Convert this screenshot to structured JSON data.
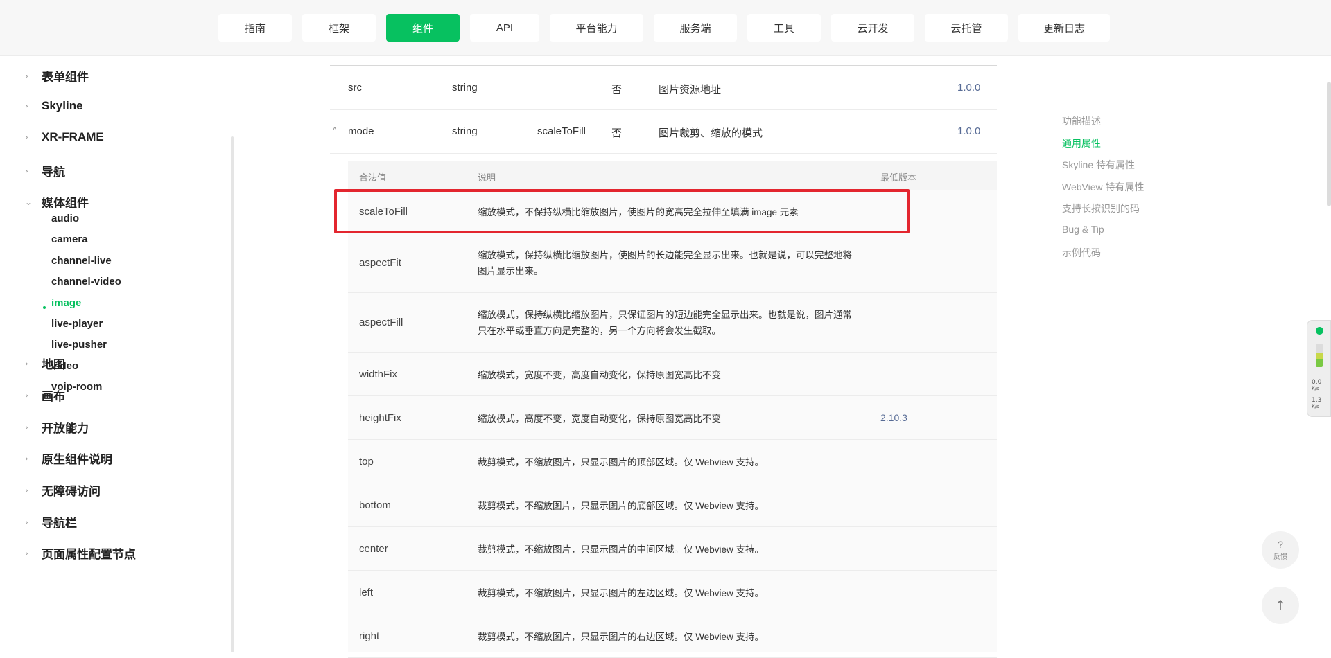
{
  "topnav": {
    "items": [
      {
        "label": "指南",
        "width": 106,
        "active": false
      },
      {
        "label": "框架",
        "width": 106,
        "active": false
      },
      {
        "label": "组件",
        "width": 106,
        "active": true
      },
      {
        "label": "API",
        "width": 100,
        "active": false
      },
      {
        "label": "平台能力",
        "width": 135,
        "active": false
      },
      {
        "label": "服务端",
        "width": 120,
        "active": false
      },
      {
        "label": "工具",
        "width": 106,
        "active": false
      },
      {
        "label": "云开发",
        "width": 120,
        "active": false
      },
      {
        "label": "云托管",
        "width": 120,
        "active": false
      },
      {
        "label": "更新日志",
        "width": 132,
        "active": false
      }
    ]
  },
  "sidebar": {
    "groups_top": [
      {
        "label": "表单组件",
        "chevron": "›"
      },
      {
        "label": "Skyline",
        "chevron": "›"
      },
      {
        "label": "XR-FRAME",
        "chevron": "›"
      },
      {
        "label": "导航",
        "chevron": "›"
      },
      {
        "label": "媒体组件",
        "chevron": "⌄"
      }
    ],
    "media_items": [
      {
        "label": "audio",
        "active": false
      },
      {
        "label": "camera",
        "active": false
      },
      {
        "label": "channel-live",
        "active": false
      },
      {
        "label": "channel-video",
        "active": false
      },
      {
        "label": "image",
        "active": true
      },
      {
        "label": "live-player",
        "active": false
      },
      {
        "label": "live-pusher",
        "active": false
      },
      {
        "label": "video",
        "active": false
      },
      {
        "label": "voip-room",
        "active": false
      }
    ],
    "groups_bottom": [
      {
        "label": "地图",
        "chevron": "›"
      },
      {
        "label": "画布",
        "chevron": "›"
      },
      {
        "label": "开放能力",
        "chevron": "›"
      },
      {
        "label": "原生组件说明",
        "chevron": "›"
      },
      {
        "label": "无障碍访问",
        "chevron": "›"
      },
      {
        "label": "导航栏",
        "chevron": "›"
      },
      {
        "label": "页面属性配置节点",
        "chevron": "›"
      }
    ]
  },
  "attrs": [
    {
      "name": "src",
      "type": "string",
      "default": "",
      "required": "否",
      "desc": "图片资源地址",
      "version": "1.0.0",
      "expander": ""
    },
    {
      "name": "mode",
      "type": "string",
      "default": "scaleToFill",
      "required": "否",
      "desc": "图片裁剪、缩放的模式",
      "version": "1.0.0",
      "expander": "^"
    }
  ],
  "subtable": {
    "headers": {
      "value": "合法值",
      "desc": "说明",
      "version": "最低版本"
    },
    "rows": [
      {
        "name": "scaleToFill",
        "desc": "缩放模式，不保持纵横比缩放图片，使图片的宽高完全拉伸至填满 image 元素",
        "version": ""
      },
      {
        "name": "aspectFit",
        "desc": "缩放模式，保持纵横比缩放图片，使图片的长边能完全显示出来。也就是说，可以完整地将图片显示出来。",
        "version": ""
      },
      {
        "name": "aspectFill",
        "desc": "缩放模式，保持纵横比缩放图片，只保证图片的短边能完全显示出来。也就是说，图片通常只在水平或垂直方向是完整的，另一个方向将会发生截取。",
        "version": ""
      },
      {
        "name": "widthFix",
        "desc": "缩放模式，宽度不变，高度自动变化，保持原图宽高比不变",
        "version": ""
      },
      {
        "name": "heightFix",
        "desc": "缩放模式，高度不变，宽度自动变化，保持原图宽高比不变",
        "version": "2.10.3"
      },
      {
        "name": "top",
        "desc": "裁剪模式，不缩放图片，只显示图片的顶部区域。仅 Webview 支持。",
        "version": ""
      },
      {
        "name": "bottom",
        "desc": "裁剪模式，不缩放图片，只显示图片的底部区域。仅 Webview 支持。",
        "version": ""
      },
      {
        "name": "center",
        "desc": "裁剪模式，不缩放图片，只显示图片的中间区域。仅 Webview 支持。",
        "version": ""
      },
      {
        "name": "left",
        "desc": "裁剪模式，不缩放图片，只显示图片的左边区域。仅 Webview 支持。",
        "version": ""
      },
      {
        "name": "right",
        "desc": "裁剪模式，不缩放图片，只显示图片的右边区域。仅 Webview 支持。",
        "version": ""
      }
    ]
  },
  "toc": {
    "items": [
      {
        "label": "功能描述",
        "active": false
      },
      {
        "label": "通用属性",
        "active": true
      },
      {
        "label": "Skyline 特有属性",
        "active": false
      },
      {
        "label": "WebView 特有属性",
        "active": false
      },
      {
        "label": "支持长按识别的码",
        "active": false
      },
      {
        "label": "Bug & Tip",
        "active": false
      },
      {
        "label": "示例代码",
        "active": false
      }
    ]
  },
  "net_widget": {
    "down": "0.0",
    "down_unit": "K/s",
    "up": "1.3",
    "up_unit": "K/s"
  },
  "feedback": {
    "icon": "?",
    "label": "反馈"
  },
  "back_to_top": {
    "icon": "↑"
  },
  "colors": {
    "accent": "#07c160",
    "highlight": "#e3262f",
    "version": "#576b95"
  }
}
